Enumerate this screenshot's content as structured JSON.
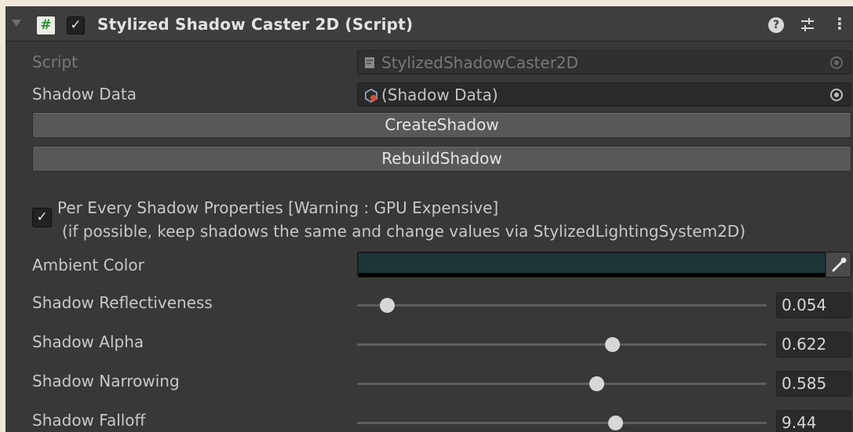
{
  "header": {
    "script_icon_glyph": "#",
    "enabled_check": "✓",
    "title": "Stylized Shadow Caster 2D (Script)",
    "help_glyph": "?",
    "menu_glyph": "⋮",
    "icons": [
      "foldout-triangle-icon",
      "script-icon",
      "help-icon",
      "presets-icon",
      "kebab-menu-icon"
    ]
  },
  "fields": {
    "script": {
      "label": "Script",
      "value": "StylizedShadowCaster2D"
    },
    "shadow_data": {
      "label": "Shadow Data",
      "value": "(Shadow Data)"
    }
  },
  "buttons": {
    "create": "CreateShadow",
    "rebuild": "RebuildShadow"
  },
  "per_shadow_toggle": {
    "checked": true,
    "check": "✓",
    "line1": "Per Every Shadow Properties [Warning : GPU Expensive]",
    "line2": "(if possible, keep shadows the same and change values via StylizedLightingSystem2D)"
  },
  "ambient": {
    "label": "Ambient Color",
    "color": "#1b3636"
  },
  "sliders": [
    {
      "label": "Shadow Reflectiveness",
      "value": "0.054",
      "fraction": 0.072
    },
    {
      "label": "Shadow Alpha",
      "value": "0.622",
      "fraction": 0.622
    },
    {
      "label": "Shadow Narrowing",
      "value": "0.585",
      "fraction": 0.585
    },
    {
      "label": "Shadow Falloff",
      "value": "9.44",
      "fraction": 0.63
    }
  ],
  "colors": {
    "panel": "#383838",
    "header": "#3e3e3e",
    "button": "#585858",
    "field": "#2a2a2a"
  }
}
